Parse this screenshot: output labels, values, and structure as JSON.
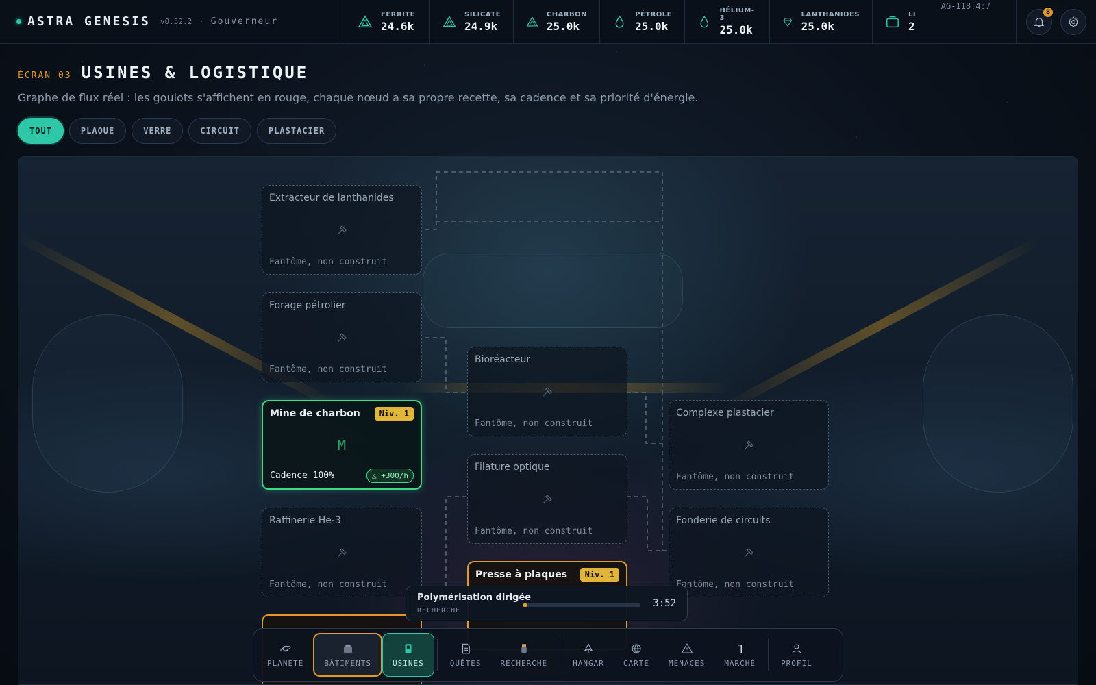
{
  "app": {
    "name": "ASTRA GENESIS",
    "version": "v0.52.2",
    "separator": "·",
    "role": "Gouverneur"
  },
  "resources": [
    {
      "label": "FERRITE",
      "value": "24.6k",
      "icon": "triangle-icon"
    },
    {
      "label": "SILICATE",
      "value": "24.9k",
      "icon": "triangle-icon"
    },
    {
      "label": "CHARBON",
      "value": "25.0k",
      "icon": "triangle-icon"
    },
    {
      "label": "PÉTROLE",
      "value": "25.0k",
      "icon": "drop-icon"
    },
    {
      "label": "HÉLIUM-3",
      "value": "25.0k",
      "icon": "drop-icon"
    },
    {
      "label": "LANTHANIDES",
      "value": "25.0k",
      "icon": "gem-icon"
    },
    {
      "label": "LI",
      "value": "2",
      "icon": "crate-icon"
    }
  ],
  "coordinates": "AG-118:4:7",
  "notifications": {
    "count": "8"
  },
  "screen": {
    "number": "ÉCRAN 03",
    "title": "USINES & LOGISTIQUE",
    "subtitle": "Graphe de flux réel : les goulots s'affichent en rouge, chaque nœud a sa propre recette, sa cadence et sa priorité d'énergie."
  },
  "filters": [
    {
      "label": "TOUT",
      "active": true
    },
    {
      "label": "PLAQUE",
      "active": false
    },
    {
      "label": "VERRE",
      "active": false
    },
    {
      "label": "CIRCUIT",
      "active": false
    },
    {
      "label": "PLASTACIER",
      "active": false
    }
  ],
  "nodes": {
    "extracteur": {
      "name": "Extracteur de lanthanides",
      "status": "Fantôme, non construit"
    },
    "forage": {
      "name": "Forage pétrolier",
      "status": "Fantôme, non construit"
    },
    "mine": {
      "name": "Mine de charbon",
      "level": "Niv. 1",
      "letter": "M",
      "cadence": "Cadence 100%",
      "rate": "+300/h"
    },
    "raffinerie": {
      "name": "Raffinerie He-3",
      "status": "Fantôme, non construit"
    },
    "bioreacteur": {
      "name": "Bioréacteur",
      "status": "Fantôme, non construit"
    },
    "filature": {
      "name": "Filature optique",
      "status": "Fantôme, non construit"
    },
    "presse": {
      "name": "Presse à plaques",
      "level": "Niv. 1"
    },
    "plastacier": {
      "name": "Complexe plastacier",
      "status": "Fantôme, non construit"
    },
    "fonderie": {
      "name": "Fonderie de circuits",
      "status": "Fantôme, non construit"
    }
  },
  "research": {
    "title": "Polymérisation dirigée",
    "subtitle": "RECHERCHE",
    "time": "3:52",
    "progress": 0.04
  },
  "nav": {
    "planete": "PLANÈTE",
    "batiments": "BÂTIMENTS",
    "usines": "USINES",
    "quetes": "QUÊTES",
    "recherche": "RECHERCHE",
    "hangar": "HANGAR",
    "carte": "CARTE",
    "menaces": "MENACES",
    "marche": "MARCHÉ",
    "profil": "PROFIL"
  },
  "colors": {
    "accent": "#2ec7a8",
    "warning": "#e09a2c",
    "built": "#3ed98a",
    "level": "#e0b53a"
  }
}
